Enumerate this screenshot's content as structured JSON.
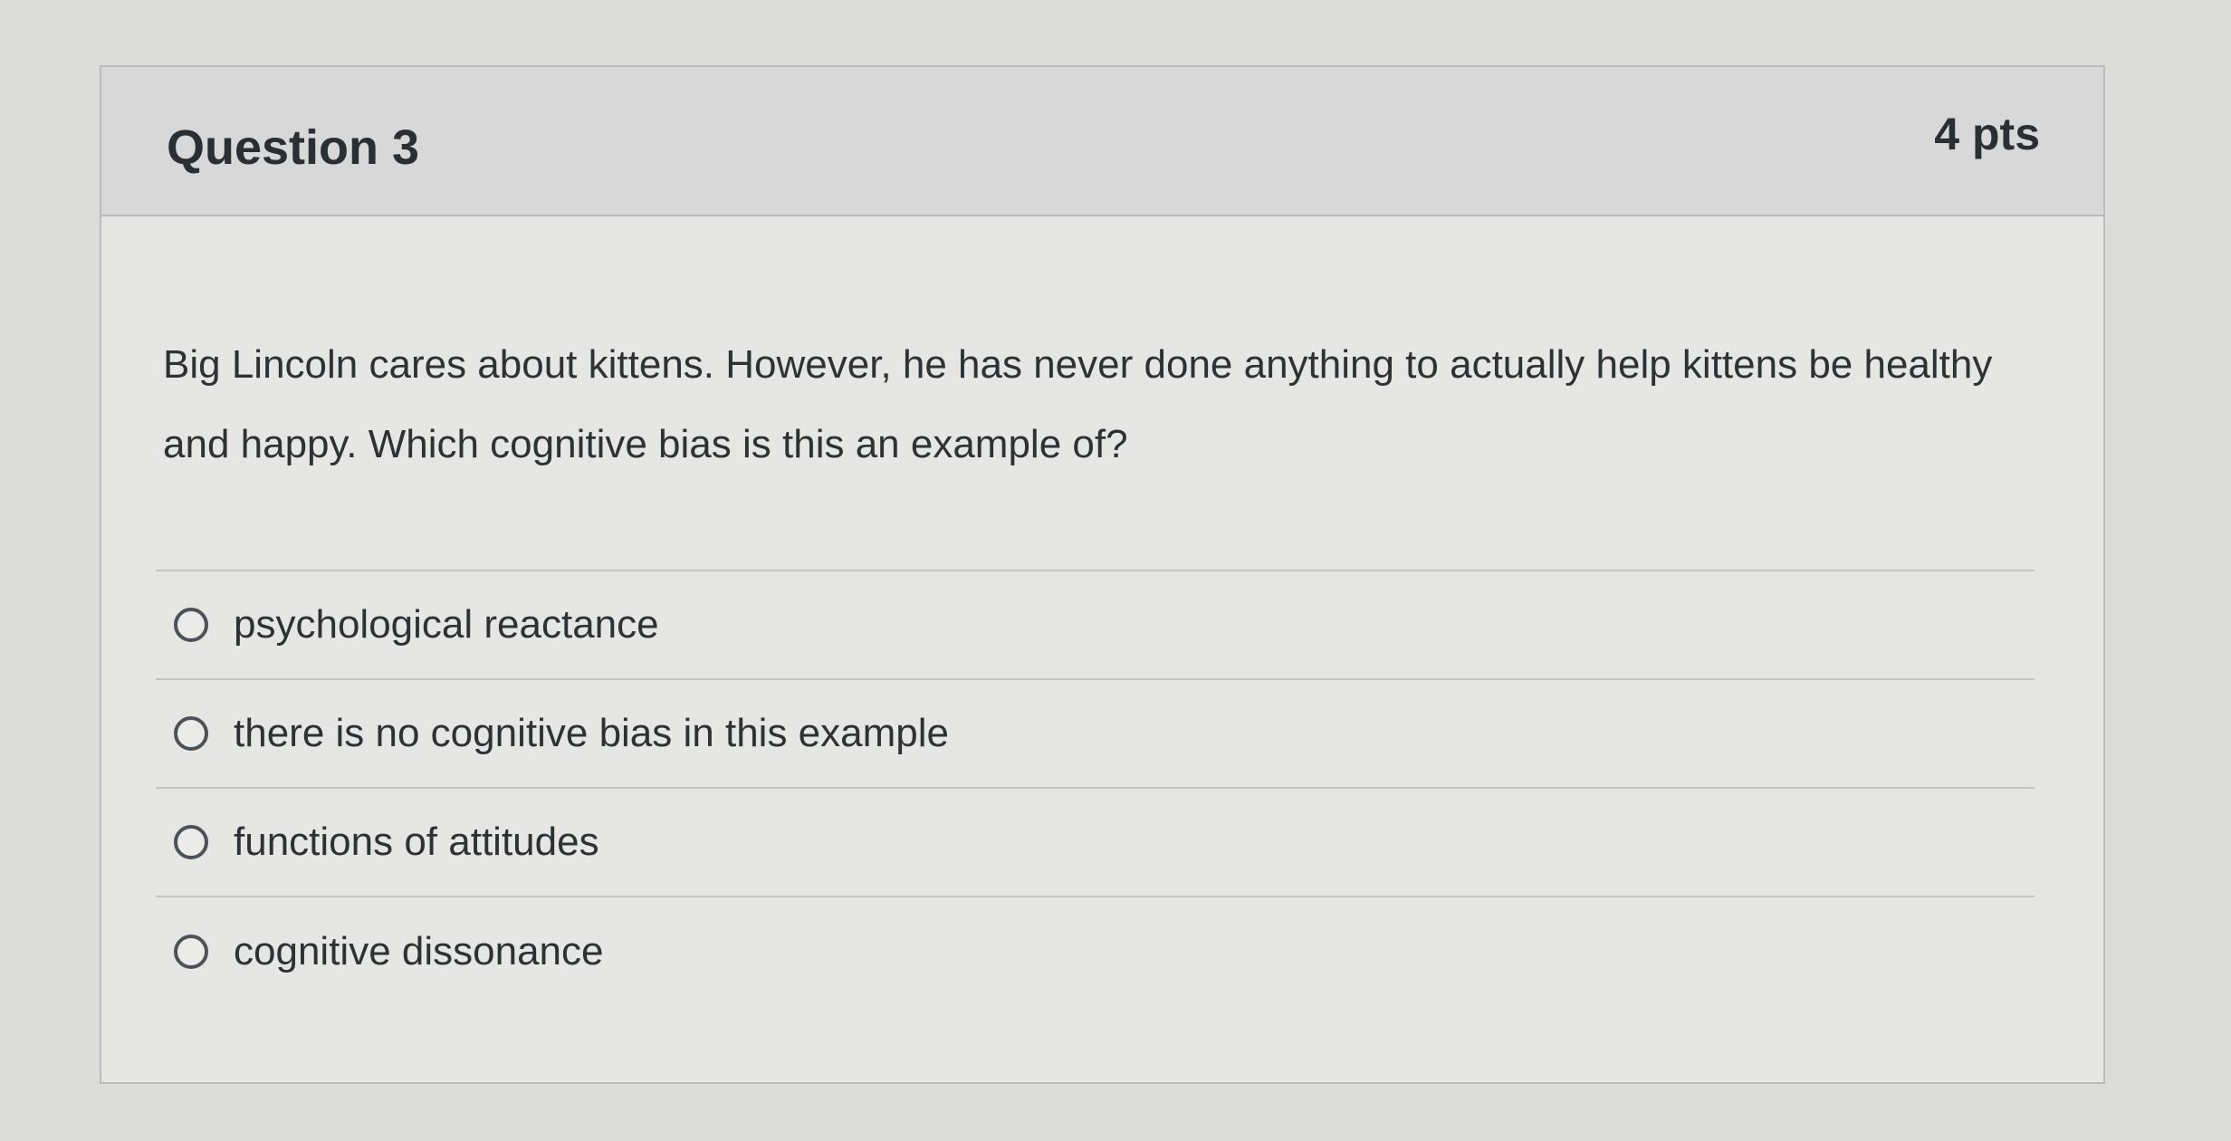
{
  "question": {
    "title": "Question 3",
    "points": "4 pts",
    "text": "Big Lincoln cares about kittens. However, he has never done anything to actually help kittens be healthy and happy. Which cognitive bias is this an example of?"
  },
  "answers": [
    {
      "label": "psychological reactance",
      "selected": false
    },
    {
      "label": "there is no cognitive bias in this example",
      "selected": false
    },
    {
      "label": "functions of attitudes",
      "selected": false
    },
    {
      "label": "cognitive dissonance",
      "selected": false
    }
  ]
}
